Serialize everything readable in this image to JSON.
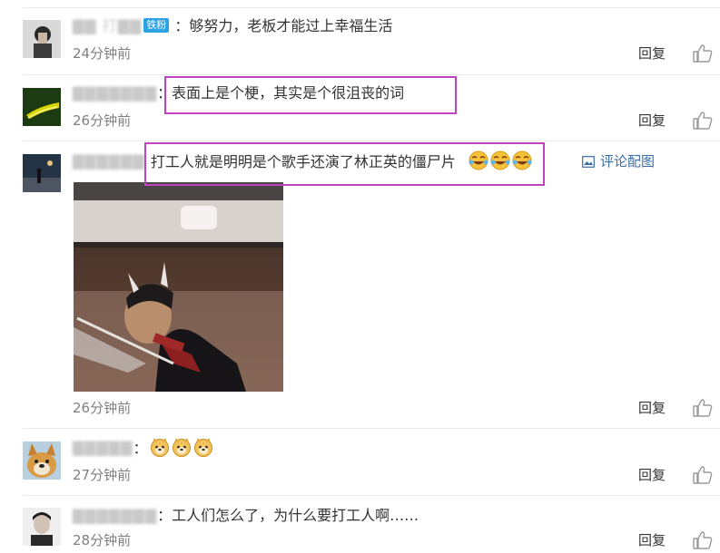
{
  "comments": [
    {
      "username": "▇▇ 打▇▇",
      "badge": "铁粉",
      "sep": "：",
      "text": "够努力，老板才能过上幸福生活",
      "time": "24分钟前",
      "reply": "回复"
    },
    {
      "username": "▇▇▇▇▇▇▇",
      "sep": "：",
      "text": "表面上是个梗，其实是个很沮丧的词",
      "time": "26分钟前",
      "reply": "回复"
    },
    {
      "username": "▇▇▇▇▇▇",
      "sep": "",
      "text": "打工人就是明明是个歌手还演了林正英的僵尸片",
      "emojis": [
        "laugh-cry",
        "laugh-cry",
        "laugh-cry"
      ],
      "pic_link": "评论配图",
      "time": "26分钟前",
      "reply": "回复"
    },
    {
      "username": "▇▇▇▇▇",
      "sep": "：",
      "emojis": [
        "doge",
        "doge",
        "doge"
      ],
      "time": "27分钟前",
      "reply": "回复"
    },
    {
      "username": "▇▇▇▇▇▇▇",
      "sep": "：",
      "text": "工人们怎么了，为什么要打工人啊……",
      "time": "28分钟前",
      "reply": "回复"
    }
  ],
  "colors": {
    "highlight": "#c243c2",
    "badge": "#2ba2e4",
    "link": "#3a6ea5",
    "time": "#808080"
  },
  "icons": [
    "thumbs-up-icon",
    "image-icon",
    "laugh-cry-emoji",
    "doge-emoji"
  ]
}
